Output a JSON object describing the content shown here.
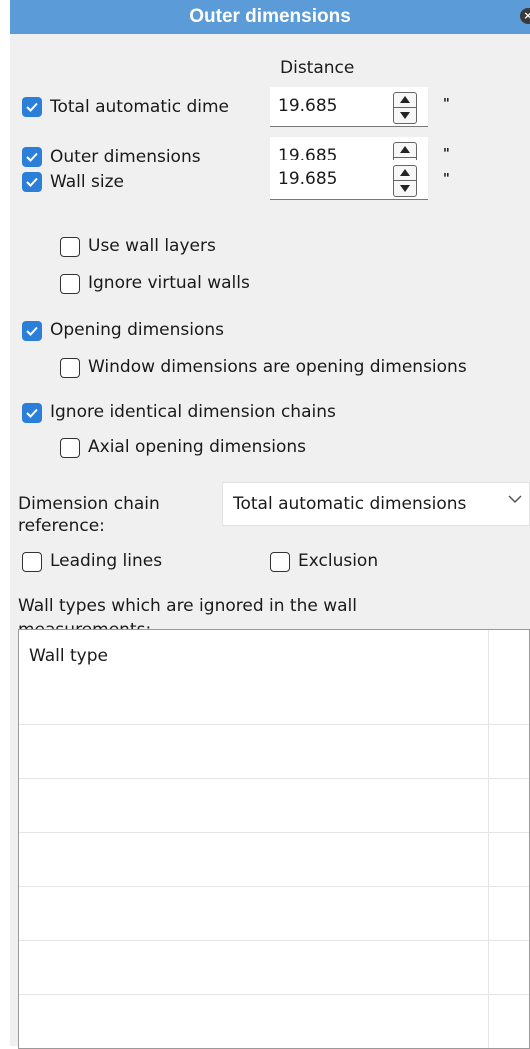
{
  "dialog": {
    "title": "Outer dimensions",
    "close_glyph": "×"
  },
  "distance_header": "Distance",
  "rows": [
    {
      "label": "Total automatic dime",
      "checked": true,
      "value": "19.685",
      "unit": "\""
    },
    {
      "label": "Outer dimensions",
      "checked": true,
      "value": "19.685",
      "unit": "\""
    },
    {
      "label": "Wall size",
      "checked": true,
      "value": "19.685",
      "unit": "\""
    }
  ],
  "wall_options": {
    "use_wall_layers": {
      "label": "Use wall layers",
      "checked": false
    },
    "ignore_virtual_walls": {
      "label": "Ignore virtual walls",
      "checked": false
    }
  },
  "opening_dimensions": {
    "label": "Opening dimensions",
    "checked": true
  },
  "window_dimensions": {
    "label": "Window dimensions are opening dimensions",
    "checked": false
  },
  "ignore_identical": {
    "label": "Ignore identical dimension chains",
    "checked": true
  },
  "axial_opening": {
    "label": "Axial opening dimensions",
    "checked": false
  },
  "chain_reference": {
    "label_line1": "Dimension chain",
    "label_line2": "reference:",
    "value": "Total automatic dimensions"
  },
  "leading_lines": {
    "label": "Leading lines",
    "checked": false
  },
  "exclusion": {
    "label": "Exclusion",
    "checked": false
  },
  "wall_types_caption": "Wall types which are ignored in the wall measurements:",
  "table": {
    "header": "Wall type"
  },
  "colors": {
    "title_bar": "#5b9bd8",
    "checkbox_on": "#2b7fd8",
    "panel": "#f0f0f0"
  }
}
